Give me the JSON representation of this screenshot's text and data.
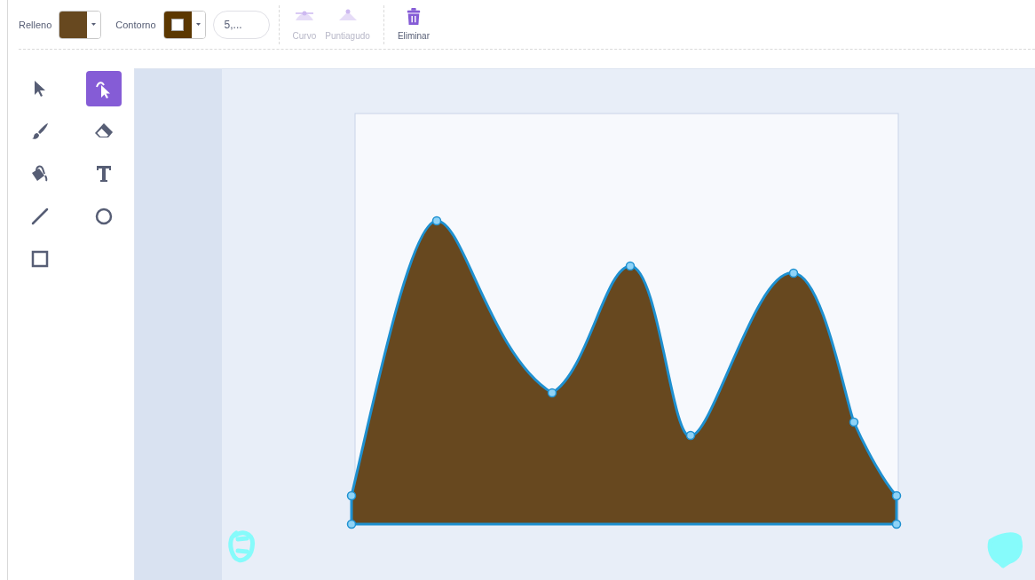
{
  "toolbar": {
    "fill": {
      "label": "Relleno",
      "color": "#67481f"
    },
    "outline": {
      "label": "Contorno",
      "color": "#5b3700"
    },
    "outline_width": {
      "value": "5,..."
    },
    "actions": [
      {
        "kind": "curved",
        "label": "Curvo",
        "disabled": true
      },
      {
        "kind": "pointed",
        "label": "Puntiagudo",
        "disabled": true
      },
      {
        "kind": "delete",
        "label": "Eliminar",
        "disabled": false
      }
    ]
  },
  "tools": [
    {
      "kind": "select",
      "selected": false
    },
    {
      "kind": "reshape",
      "selected": true
    },
    {
      "kind": "brush",
      "selected": false
    },
    {
      "kind": "eraser",
      "selected": false
    },
    {
      "kind": "fill",
      "selected": false
    },
    {
      "kind": "text",
      "selected": false
    },
    {
      "kind": "line",
      "selected": false
    },
    {
      "kind": "circle",
      "selected": false
    },
    {
      "kind": "rect",
      "selected": false
    }
  ]
}
